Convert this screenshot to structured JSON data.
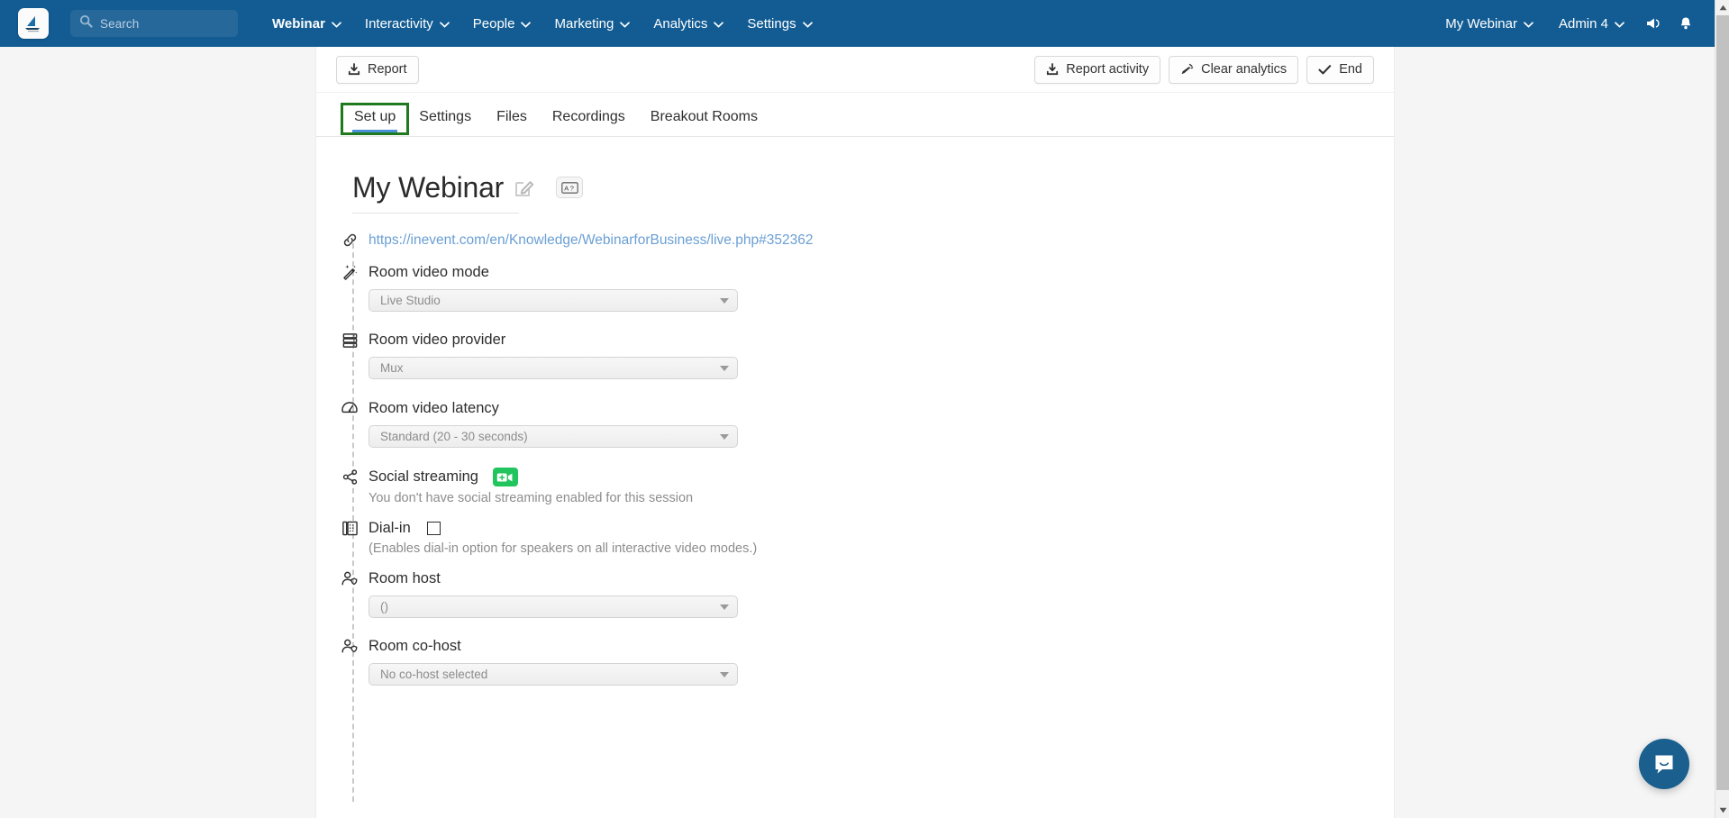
{
  "navbar": {
    "logo_name": "inevent-logo",
    "search": {
      "placeholder": "Search"
    },
    "items": [
      {
        "label": "Webinar",
        "bold": true
      },
      {
        "label": "Interactivity",
        "bold": false
      },
      {
        "label": "People",
        "bold": false
      },
      {
        "label": "Marketing",
        "bold": false
      },
      {
        "label": "Analytics",
        "bold": false
      },
      {
        "label": "Settings",
        "bold": false
      }
    ],
    "right": [
      {
        "label": "My Webinar"
      },
      {
        "label": "Admin 4"
      }
    ],
    "announce_icon": "megaphone-icon",
    "notifications_icon": "bell-icon",
    "background_color": "#125c93"
  },
  "toolbar": {
    "report_label": "Report",
    "report_activity_label": "Report activity",
    "clear_analytics_label": "Clear analytics",
    "end_label": "End"
  },
  "tabs": [
    {
      "label": "Set up",
      "active": true,
      "highlighted": true
    },
    {
      "label": "Settings",
      "active": false,
      "highlighted": false
    },
    {
      "label": "Files",
      "active": false,
      "highlighted": false
    },
    {
      "label": "Recordings",
      "active": false,
      "highlighted": false
    },
    {
      "label": "Breakout Rooms",
      "active": false,
      "highlighted": false
    }
  ],
  "highlight_color": "#1f7a1f",
  "accent_color": "#4a90d9",
  "main": {
    "title": "My Webinar",
    "edit_icon": "pencil-edit-icon",
    "language_badge_icon": "translate-badge-icon",
    "link": {
      "icon": "link-chain-icon",
      "url": "https://inevent.com/en/Knowledge/WebinarforBusiness/live.php#352362"
    },
    "fields": [
      {
        "icon": "magic-wand-icon",
        "label": "Room video mode",
        "value": "Live Studio"
      },
      {
        "icon": "server-rack-icon",
        "label": "Room video provider",
        "value": "Mux"
      },
      {
        "icon": "speedometer-icon",
        "label": "Room video latency",
        "value": "Standard (20 - 30 seconds)"
      }
    ],
    "social_streaming": {
      "icon": "share-nodes-icon",
      "label": "Social streaming",
      "badge_icon": "add-video-icon",
      "badge_color": "#22c45d",
      "helper": "You don't have social streaming enabled for this session"
    },
    "dial_in": {
      "icon": "dial-pad-icon",
      "label": "Dial-in",
      "checked": false,
      "helper": "(Enables dial-in option for speakers on all interactive video modes.)"
    },
    "hosts": [
      {
        "icon": "user-shield-icon",
        "label": "Room host",
        "value": "()"
      },
      {
        "icon": "user-shield-icon",
        "label": "Room co-host",
        "value": "No co-host selected"
      }
    ]
  },
  "intercom": {
    "icon": "chat-bubble-smile-icon",
    "color": "#1b5f8f"
  }
}
